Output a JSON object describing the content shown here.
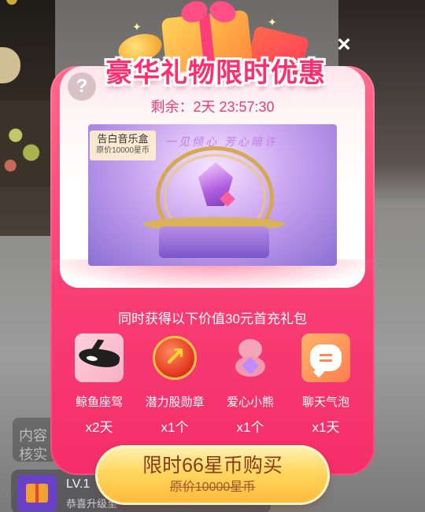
{
  "background": {
    "top_text": "",
    "chat_text_1": "内容",
    "chat_text_2": "核实",
    "level_card": {
      "title": "LV.1",
      "subtitle": "恭喜升级至"
    }
  },
  "dialog": {
    "title": "豪华礼物限时优惠",
    "countdown_label": "剩余：",
    "countdown_value": "2天 23:57:30",
    "product": {
      "name": "告白音乐盒",
      "original_price": "原价10000星币",
      "slogan": "一见倾心 芳心暗许"
    },
    "bundle_heading": "同时获得以下价值30元首充礼包",
    "rewards": [
      {
        "name": "鲸鱼座驾",
        "qty": "x2天",
        "icon": "whale-icon"
      },
      {
        "name": "潜力股勋章",
        "qty": "x1个",
        "icon": "medal-icon"
      },
      {
        "name": "爱心小熊",
        "qty": "x1个",
        "icon": "bear-icon"
      },
      {
        "name": "聊天气泡",
        "qty": "x1天",
        "icon": "chat-bubble-icon"
      }
    ],
    "buy_button": {
      "label": "限时66星币购买",
      "original_price": "原价10000星币"
    },
    "close_glyph": "×",
    "help_glyph": "?"
  },
  "colors": {
    "accent_pink": "#f83e73",
    "title_pink": "#ff2f6e",
    "button_gold": "#ffd75f"
  }
}
